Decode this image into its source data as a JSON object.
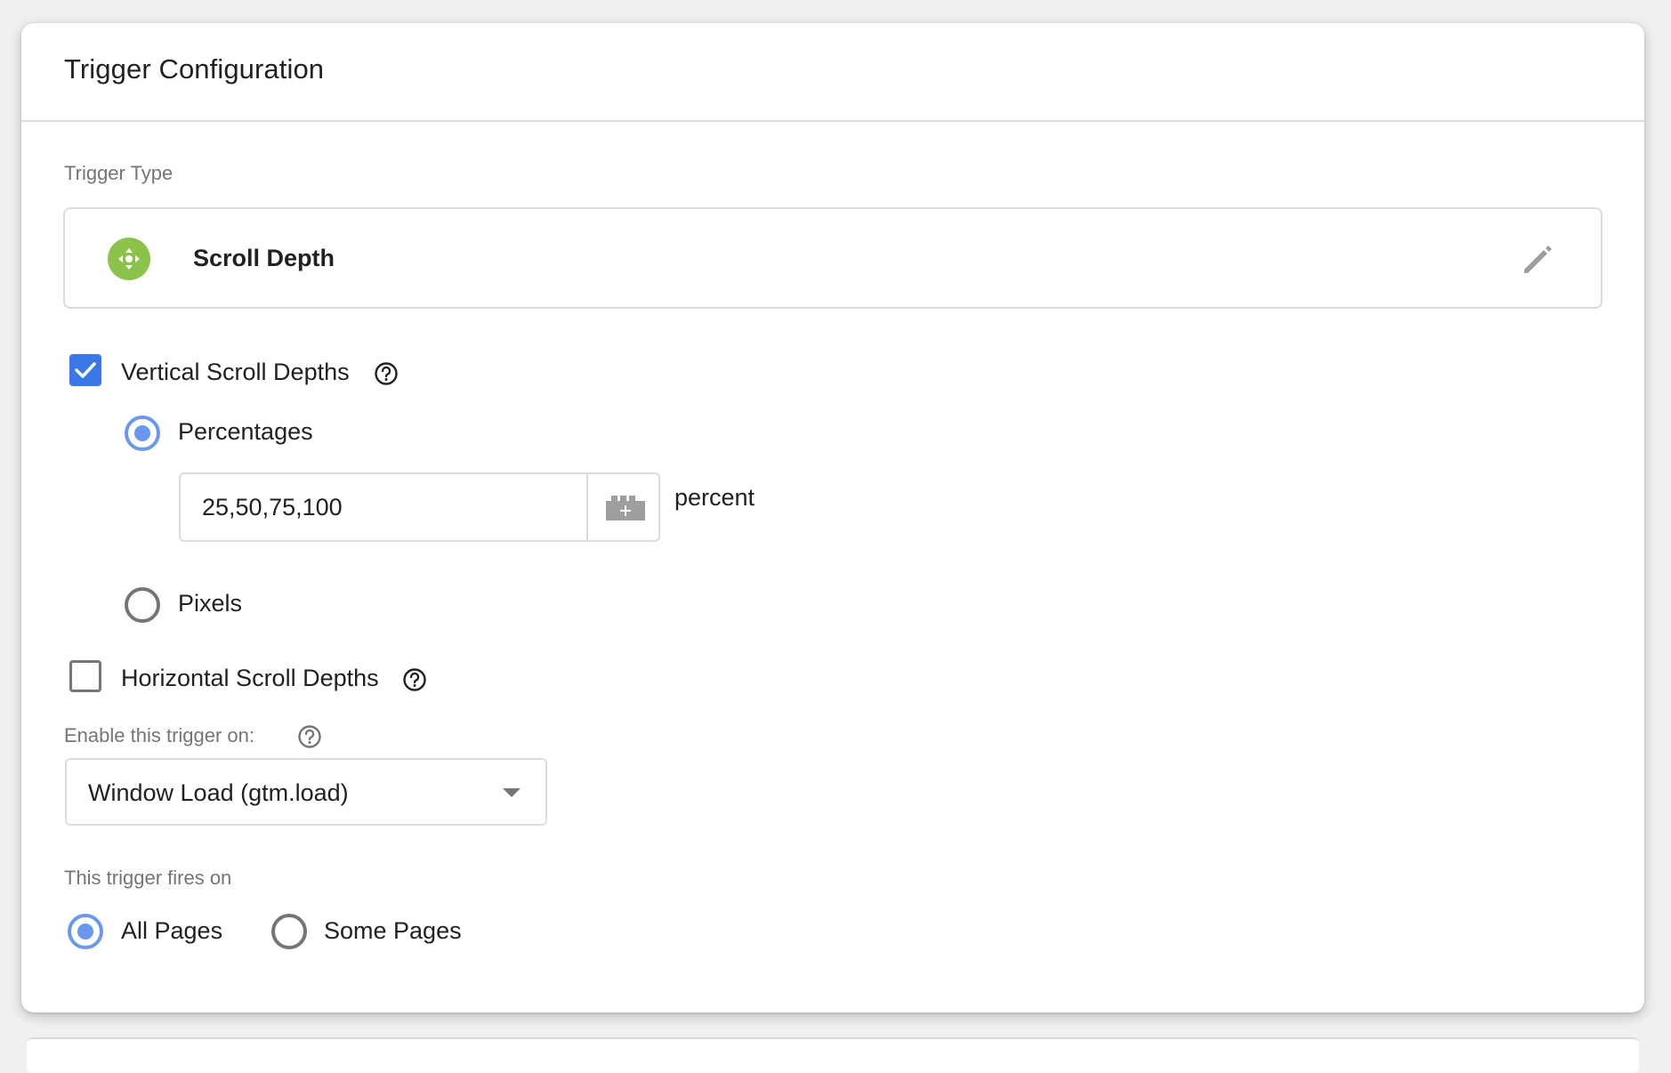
{
  "card": {
    "title": "Trigger Configuration"
  },
  "trigger_type": {
    "label": "Trigger Type",
    "name": "Scroll Depth",
    "icon": "scroll-depth-icon",
    "icon_color": "#8bc34a",
    "edit_icon": "pencil-icon"
  },
  "vertical": {
    "label": "Vertical Scroll Depths",
    "checked": true,
    "help_icon": "help-circle-icon",
    "options": [
      {
        "label": "Percentages",
        "selected": true
      },
      {
        "label": "Pixels",
        "selected": false
      }
    ],
    "percent_input": {
      "value": "25,50,75,100",
      "unit": "percent",
      "variable_icon": "add-variable-icon"
    }
  },
  "horizontal": {
    "label": "Horizontal Scroll Depths",
    "checked": false,
    "help_icon": "help-circle-icon"
  },
  "enable_on": {
    "label": "Enable this trigger on:",
    "help_icon": "help-circle-icon",
    "selected": "Window Load (gtm.load)"
  },
  "fires_on": {
    "label": "This trigger fires on",
    "options": [
      {
        "label": "All Pages",
        "selected": true
      },
      {
        "label": "Some Pages",
        "selected": false
      }
    ]
  },
  "colors": {
    "accent": "#3b78e7",
    "radio_active": "#6a98ef",
    "muted_text": "#757575",
    "border": "#dadce0"
  }
}
